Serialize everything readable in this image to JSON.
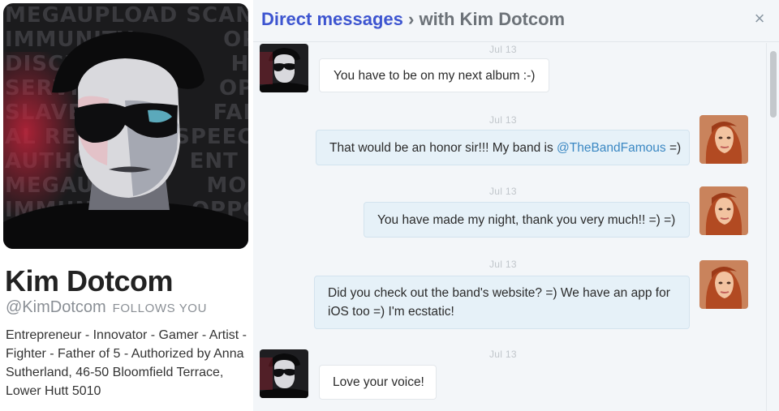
{
  "profile": {
    "name": "Kim Dotcom",
    "handle": "@KimDotcom",
    "follows_you": "FOLLOWS YOU",
    "bio": "Entrepreneur - Innovator - Gamer - Artist - Fighter - Father of 5 - Authorized by Anna Sutherland, 46-50 Bloomfield Terrace, Lower Hutt 5010"
  },
  "dm": {
    "title_link": "Direct messages",
    "title_rest": "› with Kim Dotcom",
    "close_icon": "×",
    "messages": [
      {
        "direction": "incoming",
        "timestamp": "Jul 13",
        "text": "You have to be on my next album :-)"
      },
      {
        "direction": "outgoing",
        "timestamp": "Jul 13",
        "text_before": "That would be an honor sir!!! My band is ",
        "mention": "@TheBandFamous",
        "text_after": " =)"
      },
      {
        "direction": "outgoing",
        "timestamp": "Jul 13",
        "text": "You have made my night, thank you very much!! =) =)"
      },
      {
        "direction": "outgoing",
        "timestamp": "Jul 13",
        "text": "Did you check out the band's website? =) We have an app for iOS too =) I'm ecstatic!"
      },
      {
        "direction": "incoming",
        "timestamp": "Jul 13",
        "text": "Love your voice!"
      }
    ]
  },
  "colors": {
    "title_link": "#3d55d0",
    "mention": "#3b88c3",
    "outgoing_bubble": "#e6f1f8",
    "panel_bg": "#f3f6f9"
  }
}
